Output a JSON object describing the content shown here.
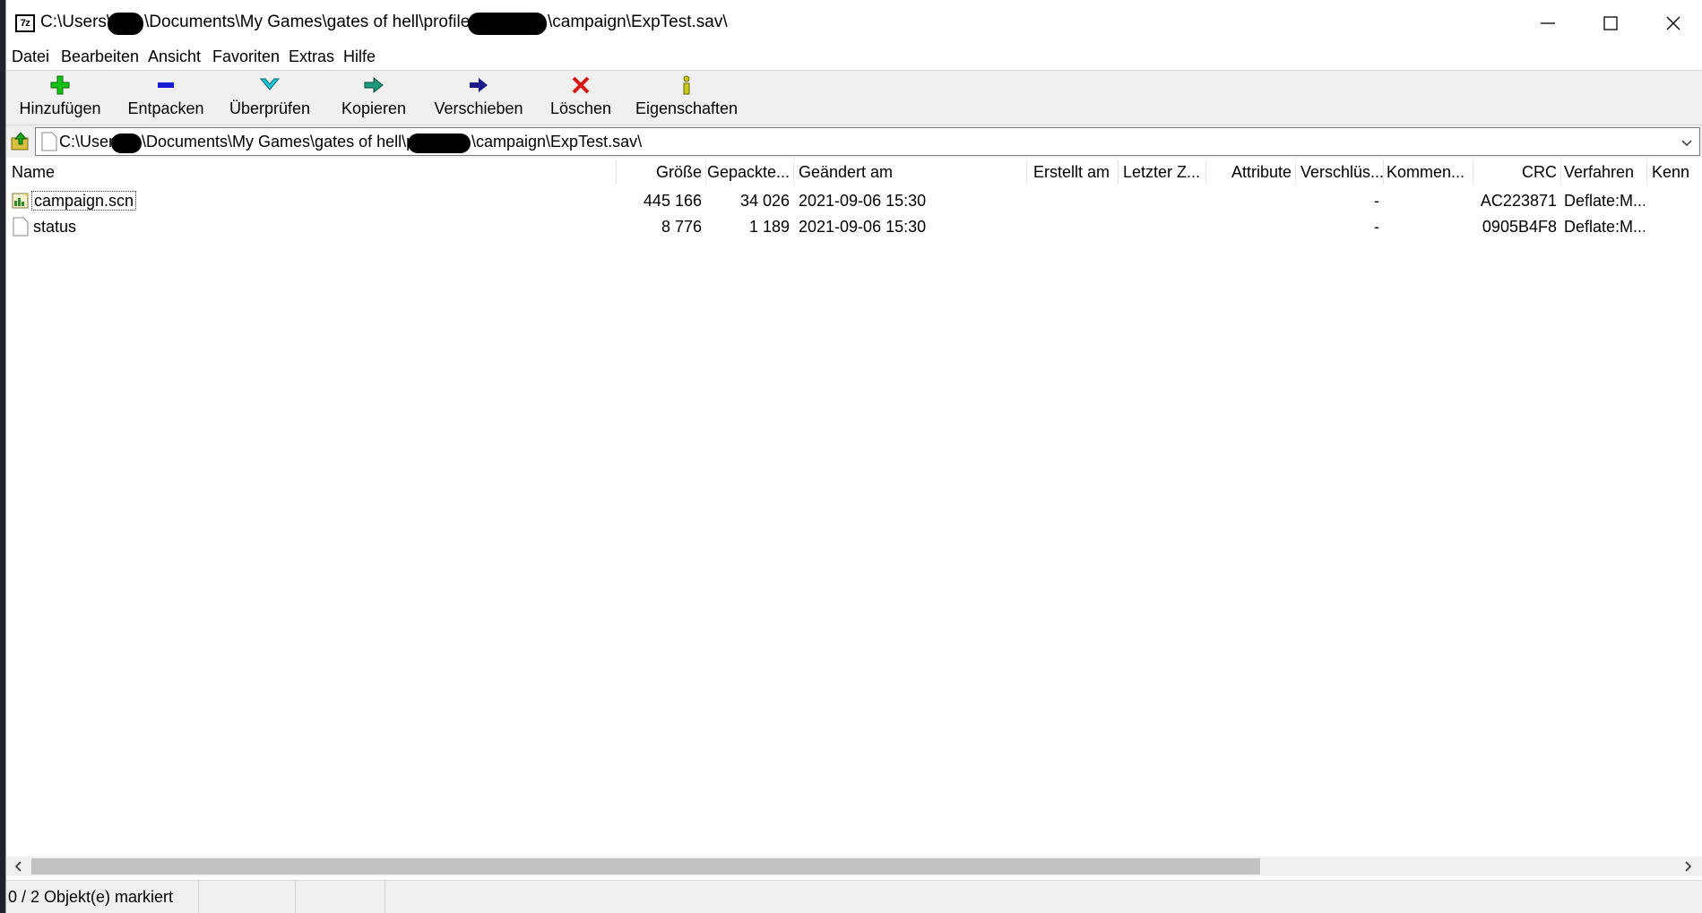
{
  "window": {
    "title_parts": [
      "C:\\Users\\",
      "\\Documents\\My Games\\gates of hell\\profiles\\",
      "\\campaign\\ExpTest.sav\\"
    ],
    "app_icon_text": "7z"
  },
  "menu": [
    "Datei",
    "Bearbeiten",
    "Ansicht",
    "Favoriten",
    "Extras",
    "Hilfe"
  ],
  "toolbar": {
    "buttons": [
      {
        "label": "Hinzufügen",
        "icon": "add-icon",
        "color": "#18b818"
      },
      {
        "label": "Entpacken",
        "icon": "extract-icon",
        "color": "#1a1ad4"
      },
      {
        "label": "Überprüfen",
        "icon": "test-icon",
        "color": "#1ab8c8"
      },
      {
        "label": "Kopieren",
        "icon": "copy-icon",
        "color": "#1a9a7a"
      },
      {
        "label": "Verschieben",
        "icon": "move-icon",
        "color": "#1a1a8a"
      },
      {
        "label": "Löschen",
        "icon": "delete-icon",
        "color": "#d81818"
      },
      {
        "label": "Eigenschaften",
        "icon": "info-icon",
        "color": "#c8c818"
      }
    ]
  },
  "address": {
    "parts": [
      "C:\\Users\\",
      "\\Documents\\My Games\\gates of hell\\profiles\\",
      "\\campaign\\ExpTest.sav\\"
    ]
  },
  "columns": [
    "Name",
    "Größe",
    "Gepackte...",
    "Geändert am",
    "Erstellt am",
    "Letzter Z...",
    "Attribute",
    "Verschlüs...",
    "Kommen...",
    "CRC",
    "Verfahren",
    "Kenn"
  ],
  "files": [
    {
      "name": "campaign.scn",
      "size": "445 166",
      "packed": "34 026",
      "modified": "2021-09-06 15:30",
      "encrypted": "-",
      "crc": "AC223871",
      "method": "Deflate:M...",
      "icon": "scn-file-icon"
    },
    {
      "name": "status",
      "size": "8 776",
      "packed": "1 189",
      "modified": "2021-09-06 15:30",
      "encrypted": "-",
      "crc": "0905B4F8",
      "method": "Deflate:M...",
      "icon": "blank-file-icon"
    }
  ],
  "status": {
    "selection": "0 / 2 Objekt(e) markiert"
  }
}
